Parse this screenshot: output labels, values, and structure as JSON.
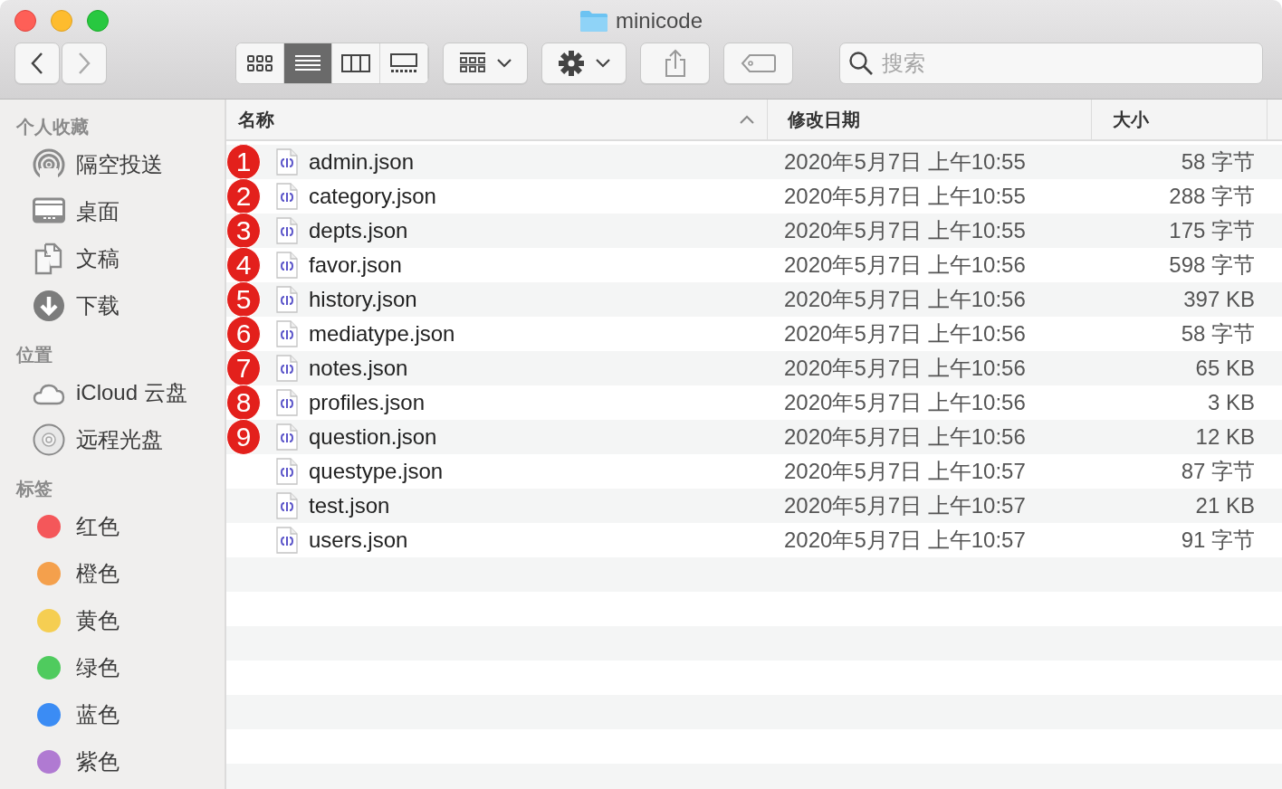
{
  "window": {
    "title": "minicode"
  },
  "toolbar": {
    "view_modes": [
      {
        "kind": "icons",
        "selected": false
      },
      {
        "kind": "list",
        "selected": true
      },
      {
        "kind": "columns",
        "selected": false
      },
      {
        "kind": "gallery",
        "selected": false
      }
    ],
    "search": {
      "placeholder": "搜索"
    }
  },
  "sidebar": [
    {
      "title": "个人收藏",
      "items": [
        {
          "label": "隔空投送",
          "kind": "airdrop"
        },
        {
          "label": "桌面",
          "kind": "desktop"
        },
        {
          "label": "文稿",
          "kind": "documents"
        },
        {
          "label": "下载",
          "kind": "downloads"
        }
      ]
    },
    {
      "title": "位置",
      "items": [
        {
          "label": "iCloud 云盘",
          "kind": "cloud"
        },
        {
          "label": "远程光盘",
          "kind": "disc"
        }
      ]
    },
    {
      "title": "标签",
      "items": [
        {
          "label": "红色",
          "kind": "tag",
          "color": "#f4575a"
        },
        {
          "label": "橙色",
          "kind": "tag",
          "color": "#f4a04c"
        },
        {
          "label": "黄色",
          "kind": "tag",
          "color": "#f5ce52"
        },
        {
          "label": "绿色",
          "kind": "tag",
          "color": "#4fcb5e"
        },
        {
          "label": "蓝色",
          "kind": "tag",
          "color": "#3b8cf4"
        },
        {
          "label": "紫色",
          "kind": "tag",
          "color": "#b07ad2"
        }
      ]
    }
  ],
  "table": {
    "columns": [
      {
        "label": "名称",
        "sorted": true
      },
      {
        "label": "修改日期",
        "sorted": false
      },
      {
        "label": "大小",
        "sorted": false
      }
    ],
    "rows": [
      {
        "badge": "1",
        "name": "admin.json",
        "modified": "2020年5月7日 上午10:55",
        "size": "58 字节"
      },
      {
        "badge": "2",
        "name": "category.json",
        "modified": "2020年5月7日 上午10:55",
        "size": "288 字节"
      },
      {
        "badge": "3",
        "name": "depts.json",
        "modified": "2020年5月7日 上午10:55",
        "size": "175 字节"
      },
      {
        "badge": "4",
        "name": "favor.json",
        "modified": "2020年5月7日 上午10:56",
        "size": "598 字节"
      },
      {
        "badge": "5",
        "name": "history.json",
        "modified": "2020年5月7日 上午10:56",
        "size": "397 KB"
      },
      {
        "badge": "6",
        "name": "mediatype.json",
        "modified": "2020年5月7日 上午10:56",
        "size": "58 字节"
      },
      {
        "badge": "7",
        "name": "notes.json",
        "modified": "2020年5月7日 上午10:56",
        "size": "65 KB"
      },
      {
        "badge": "8",
        "name": "profiles.json",
        "modified": "2020年5月7日 上午10:56",
        "size": "3 KB"
      },
      {
        "badge": "9",
        "name": "question.json",
        "modified": "2020年5月7日 上午10:56",
        "size": "12 KB"
      },
      {
        "name": "questype.json",
        "modified": "2020年5月7日 上午10:57",
        "size": "87 字节"
      },
      {
        "name": "test.json",
        "modified": "2020年5月7日 上午10:57",
        "size": "21 KB"
      },
      {
        "name": "users.json",
        "modified": "2020年5月7日 上午10:57",
        "size": "91 字节"
      }
    ]
  }
}
